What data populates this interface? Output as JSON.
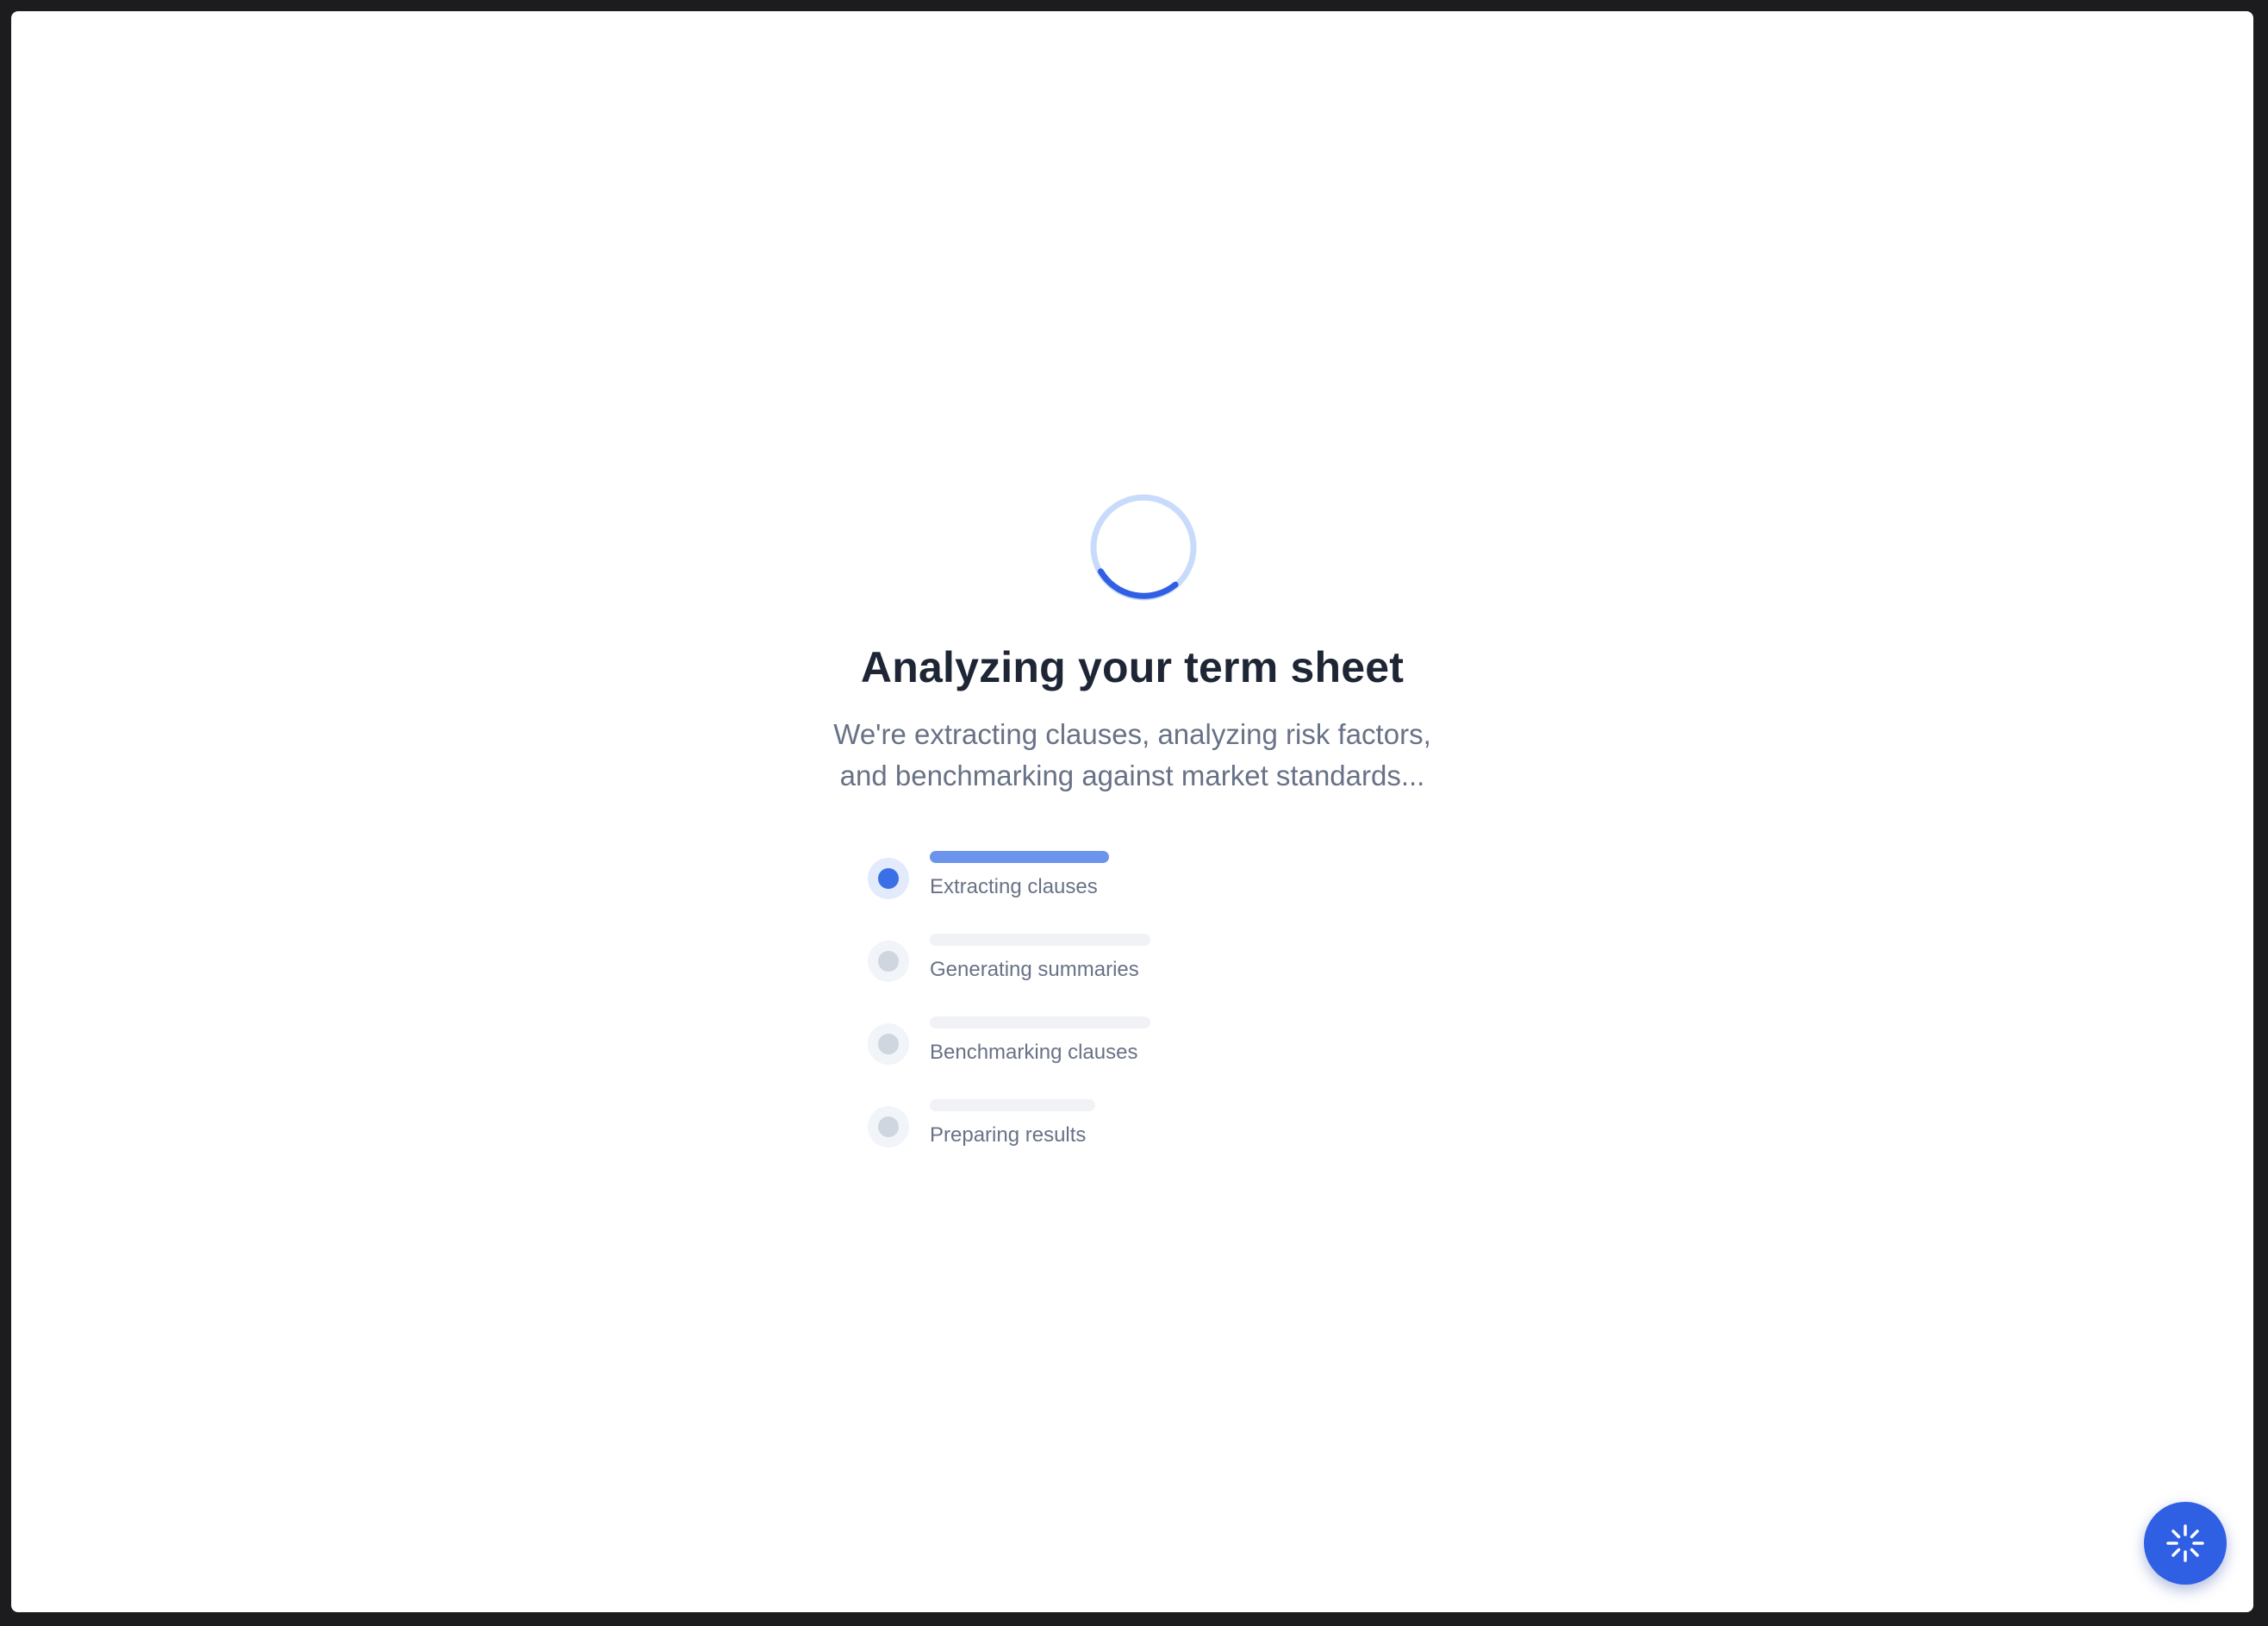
{
  "loading": {
    "title": "Analyzing your term sheet",
    "subtitle_line1": "We're extracting clauses, analyzing risk factors,",
    "subtitle_line2": "and benchmarking against market standards...",
    "spinner_icon": "loading-spinner-icon"
  },
  "steps": [
    {
      "label": "Extracting clauses",
      "status": "active"
    },
    {
      "label": "Generating summaries",
      "status": "pending"
    },
    {
      "label": "Benchmarking clauses",
      "status": "pending"
    },
    {
      "label": "Preparing results",
      "status": "pending"
    }
  ],
  "fab": {
    "icon": "sparkle-icon"
  },
  "colors": {
    "accent": "#2f5fe3",
    "active_dot": "#3b6fe6",
    "active_bar": "#6b95ec",
    "pending_dot": "#cfd6e0",
    "title": "#1e2636",
    "muted_text": "#687286"
  }
}
